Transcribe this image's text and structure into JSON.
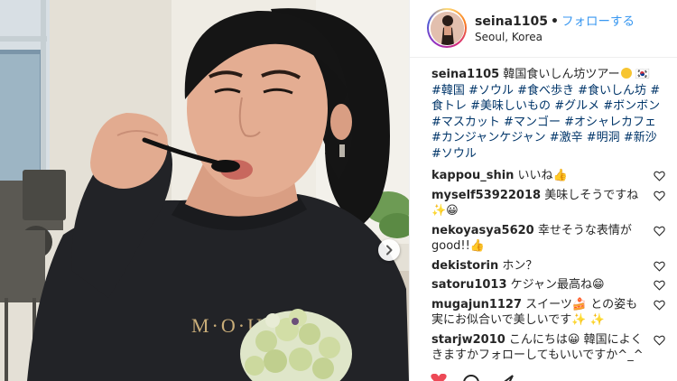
{
  "post": {
    "username": "seina1105",
    "follow_label": "フォローする",
    "location": "Seoul, Korea",
    "caption_user": "seina1105",
    "caption_text": " 韓国食いしん坊ツアー",
    "caption_flag": "🇰🇷",
    "hashtags": [
      "#韓国",
      "#ソウル",
      "#食べ歩き",
      "#食いしん坊",
      "#食トレ",
      "#美味しいもの",
      "#グルメ",
      "#ボンボン",
      "#マスカット",
      "#マンゴー",
      "#オシャレカフェ",
      "#カンジャンケジャン",
      "#激辛",
      "#明洞",
      "#新沙",
      "#ソウル"
    ]
  },
  "photo": {
    "sweatshirt_text": "M·O·U·S·Y"
  },
  "comments": [
    {
      "user": "kappou_shin",
      "text": " いいね👍"
    },
    {
      "user": "myself53922018",
      "text": " 美味しそうですね✨😀"
    },
    {
      "user": "nekoyasya5620",
      "text": " 幸せそうな表情がgood!!👍"
    },
    {
      "user": "dekistorin",
      "text": " ホン？"
    },
    {
      "user": "satoru1013",
      "text": " ケジャン最高ね😁"
    },
    {
      "user": "mugajun1127",
      "text": " スイーツ🍰 との姿も実にお似合いで美しいです✨ ✨"
    },
    {
      "user": "starjw2010",
      "text": " こんにちは😀 韓国によくきますかフォローしてもいいですか^_^"
    }
  ],
  "colors": {
    "link": "#3897f0",
    "hashtag": "#003569",
    "text": "#262626",
    "border": "#efefef"
  },
  "icons": {
    "carousel_next": "chevron-right-icon",
    "like": "heart-icon"
  }
}
